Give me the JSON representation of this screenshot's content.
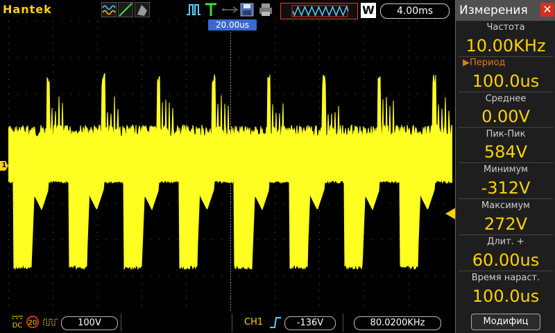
{
  "header": {
    "brand": "Hantek",
    "timebase": "4.00ms",
    "acq_mode": "W"
  },
  "grid": {
    "trigger_position": "20.00us",
    "channel_marker": "1"
  },
  "panel": {
    "title": "Измерения",
    "close": "✕",
    "items": [
      {
        "label": "Частота",
        "value": "10.00KHz",
        "selected": false
      },
      {
        "label": "Период",
        "value": "100.0us",
        "selected": true
      },
      {
        "label": "Среднее",
        "value": "0.00V",
        "selected": false
      },
      {
        "label": "Пик-Пик",
        "value": "584V",
        "selected": false
      },
      {
        "label": "Минимум",
        "value": "-312V",
        "selected": false
      },
      {
        "label": "Максимум",
        "value": "272V",
        "selected": false
      },
      {
        "label": "Длит. +",
        "value": "60.00us",
        "selected": false
      },
      {
        "label": "Время нараст.",
        "value": "100.0us",
        "selected": false
      }
    ],
    "modify_button": "Модифиц"
  },
  "bottom": {
    "coupling": "DC",
    "bw_limit": "20",
    "volts_div": "100V",
    "channel": "CH1",
    "trigger_level": "-136V",
    "frequency": "80.0200KHz"
  },
  "colors": {
    "trace": "#ffd200",
    "grid_dot": "#6a6a6a",
    "panel_value": "#ffd200",
    "accent_orange": "#e07a20"
  },
  "icons": [
    "wave-display-icon",
    "ramp-icon",
    "dots-icon",
    "pulse-icon",
    "trigger-t-icon",
    "usb-icon",
    "save-disk-icon",
    "print-icon",
    "close-icon"
  ]
}
